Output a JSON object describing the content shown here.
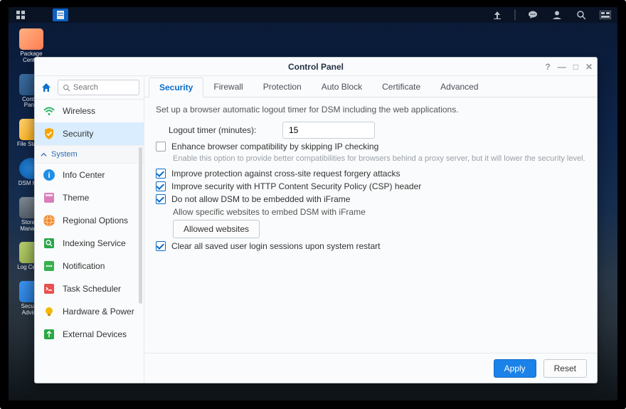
{
  "taskbar": {
    "icons": [
      "grid-icon",
      "file-manager-icon"
    ],
    "right_icons": [
      "upload-icon",
      "chat-icon",
      "user-icon",
      "search-icon",
      "dashboard-icon"
    ]
  },
  "desktop": {
    "items": [
      {
        "label": "Package Center",
        "color": "#ff9b6c"
      },
      {
        "label": "Control Panel",
        "color": "#2e5a8f"
      },
      {
        "label": "File Station",
        "color": "#f7b542"
      },
      {
        "label": "DSM Help",
        "color": "#1d6fb8"
      },
      {
        "label": "Storage Manager",
        "color": "#6b7885"
      },
      {
        "label": "Log Center",
        "color": "#9fb858"
      },
      {
        "label": "Security Advisor",
        "color": "#2a7de0"
      }
    ]
  },
  "window": {
    "title": "Control Panel",
    "controls": {
      "help": "?",
      "min": "—",
      "max": "□",
      "close": "✕"
    }
  },
  "search": {
    "placeholder": "Search"
  },
  "sidebar": {
    "top_items": [
      {
        "label": "Wireless",
        "icon": "wifi-icon",
        "color": "#2db36a"
      }
    ],
    "active": {
      "label": "Security",
      "icon": "shield-icon",
      "color": "#f7a500"
    },
    "group_label": "System",
    "items": [
      {
        "label": "Info Center",
        "icon": "info-icon",
        "color": "#1f8fe6"
      },
      {
        "label": "Theme",
        "icon": "theme-icon",
        "color": "#d87fbb"
      },
      {
        "label": "Regional Options",
        "icon": "globe-icon",
        "color": "#f18a2c"
      },
      {
        "label": "Indexing Service",
        "icon": "index-icon",
        "color": "#2aa74a"
      },
      {
        "label": "Notification",
        "icon": "bell-icon",
        "color": "#36b04d"
      },
      {
        "label": "Task Scheduler",
        "icon": "task-icon",
        "color": "#e85151"
      },
      {
        "label": "Hardware & Power",
        "icon": "bulb-icon",
        "color": "#f6b800"
      },
      {
        "label": "External Devices",
        "icon": "external-icon",
        "color": "#29a845"
      }
    ]
  },
  "tabs": [
    "Security",
    "Firewall",
    "Protection",
    "Auto Block",
    "Certificate",
    "Advanced"
  ],
  "active_tab": 0,
  "panel": {
    "intro": "Set up a browser automatic logout timer for DSM including the web applications.",
    "logout_label": "Logout timer (minutes):",
    "logout_value": "15",
    "ck_skip": "Enhance browser compatibility by skipping IP checking",
    "ck_skip_hint": "Enable this option to provide better compatibilities for browsers behind a proxy server, but it will lower the security level.",
    "ck_csrf": "Improve protection against cross-site request forgery attacks",
    "ck_csp": "Improve security with HTTP Content Security Policy (CSP) header",
    "ck_iframe": "Do not allow DSM to be embedded with iFrame",
    "iframe_sub": "Allow specific websites to embed DSM with iFrame",
    "allowed_btn": "Allowed websites",
    "ck_clear": "Clear all saved user login sessions upon system restart"
  },
  "footer": {
    "apply": "Apply",
    "reset": "Reset"
  }
}
